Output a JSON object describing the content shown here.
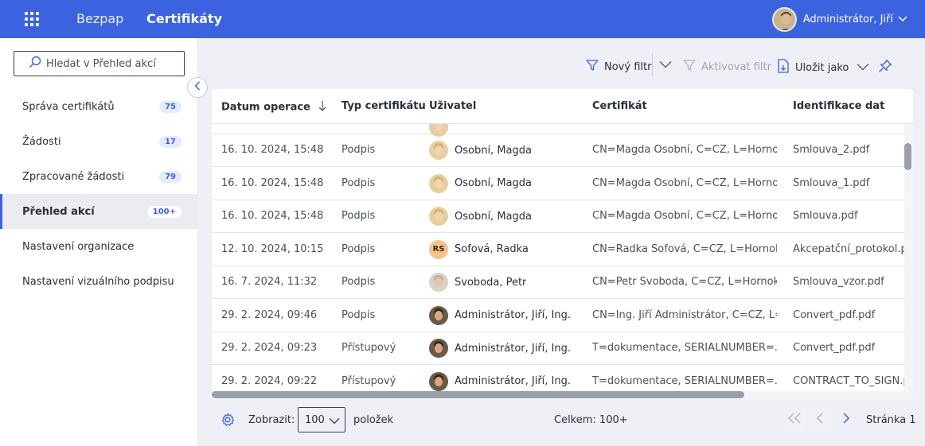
{
  "header": {
    "brand": "Bezpap",
    "product": "Certifikáty",
    "user_name": "Administrátor, Jiří"
  },
  "sidebar": {
    "search_placeholder": "Hledat v Přehled akcí",
    "items": [
      {
        "label": "Správa certifikátů",
        "badge": "75",
        "active": false
      },
      {
        "label": "Žádosti",
        "badge": "17",
        "active": false
      },
      {
        "label": "Zpracované žádosti",
        "badge": "79",
        "active": false
      },
      {
        "label": "Přehled akcí",
        "badge": "100+",
        "active": true
      },
      {
        "label": "Nastavení organizace",
        "badge": "",
        "active": false
      },
      {
        "label": "Nastavení vizuálního podpisu",
        "badge": "",
        "active": false
      }
    ]
  },
  "toolbar": {
    "new_filter": "Nový filtr",
    "activate_filter": "Aktivovat filtr",
    "save_as": "Uložit jako"
  },
  "table": {
    "columns": [
      "Datum operace",
      "Typ certifikátu",
      "Uživatel",
      "Certifikát",
      "Identifikace dat"
    ],
    "rows": [
      {
        "date": "16. 10. 2024, 15:48",
        "type": "Podpis",
        "user": "Osobní, Magda",
        "avatar": "magda",
        "initials": "",
        "cert": "CN=Magda Osobní, C=CZ, L=Horno...",
        "data": "Smlouva_2.pdf"
      },
      {
        "date": "16. 10. 2024, 15:48",
        "type": "Podpis",
        "user": "Osobní, Magda",
        "avatar": "magda",
        "initials": "",
        "cert": "CN=Magda Osobní, C=CZ, L=Horno...",
        "data": "Smlouva_1.pdf"
      },
      {
        "date": "16. 10. 2024, 15:48",
        "type": "Podpis",
        "user": "Osobní, Magda",
        "avatar": "magda",
        "initials": "",
        "cert": "CN=Magda Osobní, C=CZ, L=Horno...",
        "data": "Smlouva.pdf"
      },
      {
        "date": "12. 10. 2024, 10:15",
        "type": "Podpis",
        "user": "Sofová, Radka",
        "avatar": "rs",
        "initials": "RS",
        "cert": "CN=Radka Sofová, C=CZ, L=Hornok...",
        "data": "Akcepatční_protokol.pdf"
      },
      {
        "date": "16. 7. 2024, 11:32",
        "type": "Podpis",
        "user": "Svoboda, Petr",
        "avatar": "petr",
        "initials": "",
        "cert": "CN=Petr Svoboda, C=CZ, L=Hornokr...",
        "data": "Smlouva_vzor.pdf"
      },
      {
        "date": "29. 2. 2024, 09:46",
        "type": "Podpis",
        "user": "Administrátor, Jiří, Ing.",
        "avatar": "admin",
        "initials": "",
        "cert": "CN=Ing. Jiří Administrátor, C=CZ, L=...",
        "data": "Convert_pdf.pdf"
      },
      {
        "date": "29. 2. 2024, 09:23",
        "type": "Přístupový",
        "user": "Administrátor, Jiří, Ing.",
        "avatar": "admin",
        "initials": "",
        "cert": "T=dokumentace, SERIALNUMBER=...",
        "data": "Convert_pdf.pdf"
      },
      {
        "date": "29. 2. 2024, 09:22",
        "type": "Přístupový",
        "user": "Administrátor, Jiří, Ing.",
        "avatar": "admin",
        "initials": "",
        "cert": "T=dokumentace, SERIALNUMBER=...",
        "data": "CONTRACT_TO_SIGN.pdf"
      }
    ]
  },
  "footer": {
    "show_label": "Zobrazit:",
    "page_size": "100",
    "items_label": "položek",
    "total": "Celkem: 100+",
    "page_label": "Stránka 1"
  },
  "colors": {
    "accent": "#3b63e0",
    "badge_bg": "#e3ebff"
  }
}
